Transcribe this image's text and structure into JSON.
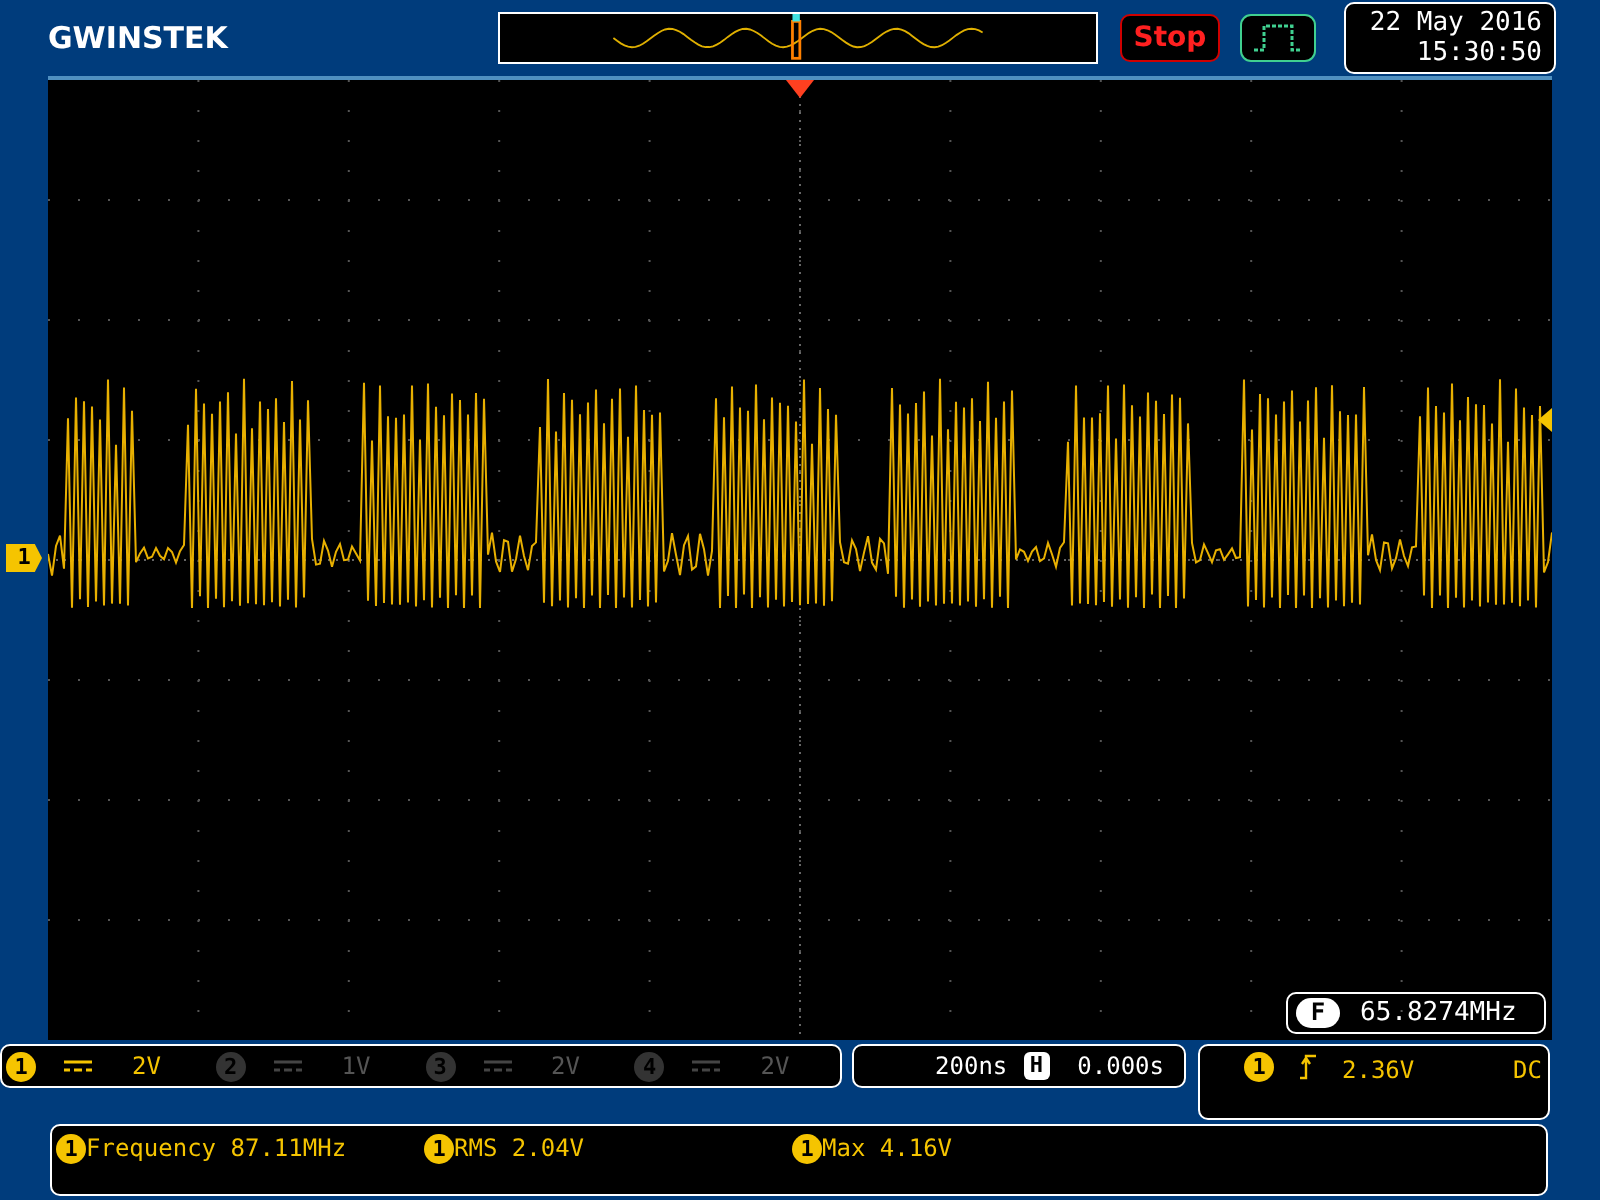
{
  "header": {
    "logo": "GWINSTEK",
    "run_state": "Stop",
    "date": "22 May 2016",
    "time": "15:30:50"
  },
  "markers": {
    "channel": "1"
  },
  "counter": {
    "label": "F",
    "value": "65.8274MHz"
  },
  "channels": [
    {
      "number": "1",
      "scale": "2V",
      "active": true
    },
    {
      "number": "2",
      "scale": "1V",
      "active": false
    },
    {
      "number": "3",
      "scale": "2V",
      "active": false
    },
    {
      "number": "4",
      "scale": "2V",
      "active": false
    }
  ],
  "timebase": {
    "scale": "200ns",
    "mode": "H",
    "position": "0.000s"
  },
  "trigger": {
    "source": "1",
    "level": "2.36V",
    "coupling": "DC"
  },
  "measurements": [
    {
      "channel": "1",
      "text": "Frequency 87.11MHz"
    },
    {
      "channel": "1",
      "text": "RMS 2.04V"
    },
    {
      "channel": "1",
      "text": "Max 4.16V"
    }
  ]
}
